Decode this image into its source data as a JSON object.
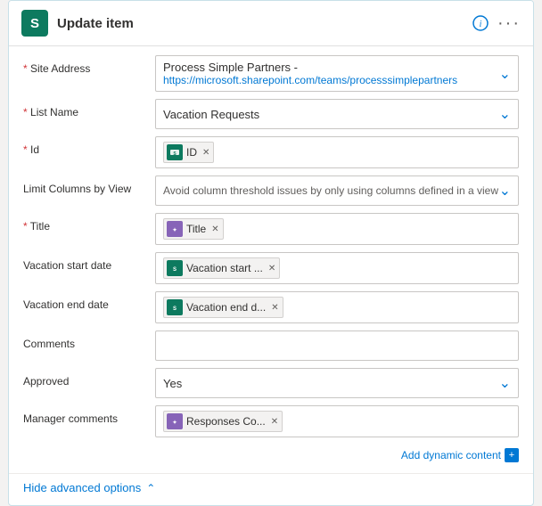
{
  "header": {
    "icon_letter": "S",
    "title": "Update item",
    "info_icon": "ⓘ",
    "more_icon": "···"
  },
  "fields": {
    "site_address": {
      "label": "Site Address",
      "required": true,
      "line1": "Process Simple Partners -",
      "line2": "https://microsoft.sharepoint.com/teams/processsimplepartners"
    },
    "list_name": {
      "label": "List Name",
      "required": true,
      "value": "Vacation Requests"
    },
    "id": {
      "label": "Id",
      "required": true,
      "tag_label": "ID",
      "tag_icon_type": "green"
    },
    "limit_columns": {
      "label": "Limit Columns by View",
      "placeholder": "Avoid column threshold issues by only using columns defined in a view"
    },
    "title": {
      "label": "Title",
      "required": true,
      "tag_label": "Title",
      "tag_icon_type": "purple"
    },
    "vacation_start": {
      "label": "Vacation start date",
      "tag_label": "Vacation start ...",
      "tag_icon_type": "green"
    },
    "vacation_end": {
      "label": "Vacation end date",
      "tag_label": "Vacation end d...",
      "tag_icon_type": "green"
    },
    "comments": {
      "label": "Comments"
    },
    "approved": {
      "label": "Approved",
      "required": false,
      "value": "Yes"
    },
    "manager_comments": {
      "label": "Manager comments",
      "tag_label": "Responses Co...",
      "tag_icon_type": "purple"
    }
  },
  "add_dynamic": {
    "label": "Add dynamic content",
    "icon": "+"
  },
  "footer": {
    "hide_label": "Hide advanced options"
  }
}
